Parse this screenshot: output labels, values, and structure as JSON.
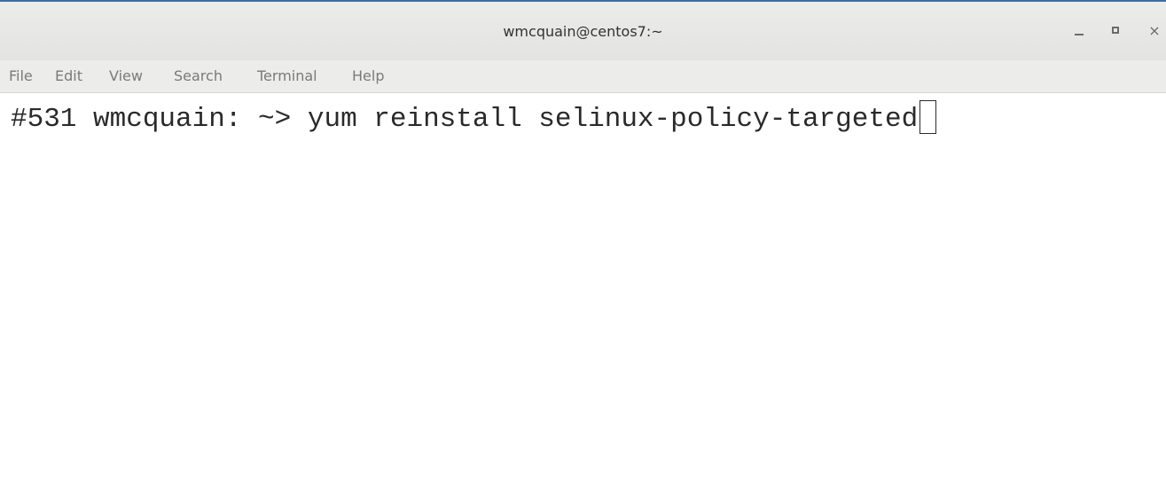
{
  "window": {
    "title": "wmcquain@centos7:~",
    "controls": {
      "minimize_icon": "minimize-icon",
      "maximize_icon": "maximize-icon",
      "close_glyph": "×"
    }
  },
  "menubar": {
    "items": [
      {
        "label": "File"
      },
      {
        "label": "Edit"
      },
      {
        "label": "View"
      },
      {
        "label": "Search"
      },
      {
        "label": "Terminal"
      },
      {
        "label": "Help"
      }
    ]
  },
  "terminal": {
    "prompt": "#531 wmcquain: ~> ",
    "command": "yum reinstall selinux-policy-targeted"
  },
  "colors": {
    "titlebar_border": "#3a6ea5",
    "menu_text": "#7a7a7a",
    "terminal_text": "#2a2a2a",
    "background": "#ffffff"
  }
}
